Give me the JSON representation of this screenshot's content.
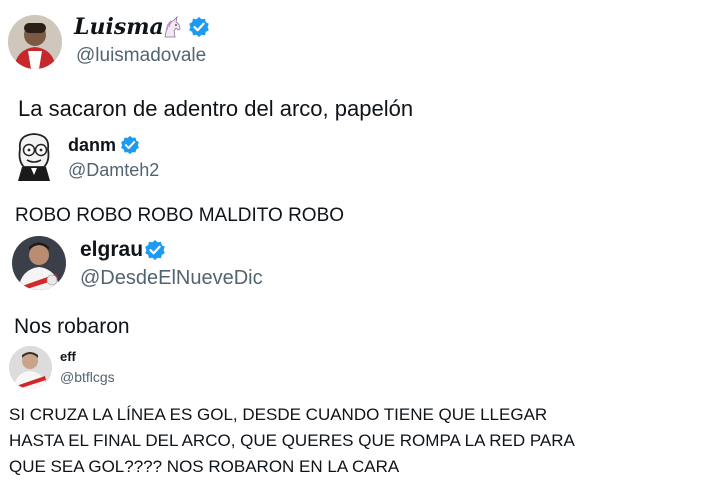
{
  "colors": {
    "verified_badge": "#1d9bf0",
    "handle_text": "#536471",
    "body_text": "#0f1419",
    "background": "#ffffff"
  },
  "tweets": [
    {
      "display_name": "Luisma",
      "name_emoji": "unicorn-emoji",
      "verified": true,
      "handle": "@luismadovale",
      "text_lines": [
        "La sacaron de adentro del arco, papelón"
      ]
    },
    {
      "display_name": "danm",
      "verified": true,
      "handle": "@Damteh2",
      "text_lines": [
        "ROBO ROBO ROBO MALDITO ROBO"
      ]
    },
    {
      "display_name": "elgrau",
      "verified": true,
      "handle": "@DesdeElNueveDic",
      "text_lines": [
        "Nos robaron"
      ]
    },
    {
      "display_name": "eff",
      "verified": false,
      "handle": "@btflcgs",
      "text_lines": [
        "SI CRUZA LA LÍNEA ES GOL, DESDE CUANDO TIENE QUE LLEGAR",
        "HASTA EL FINAL DEL ARCO, QUE QUERES QUE ROMPA LA RED PARA",
        "QUE SEA GOL???? NOS ROBARON EN LA CARA"
      ]
    }
  ]
}
